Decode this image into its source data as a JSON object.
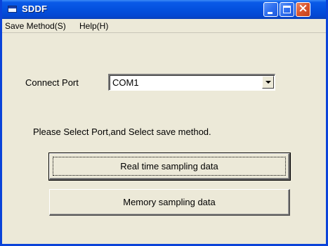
{
  "window": {
    "title": "SDDF",
    "title_icon": "app-window-icon"
  },
  "menu": {
    "items": [
      {
        "label": "Save Method(S)"
      },
      {
        "label": "Help(H)"
      }
    ]
  },
  "form": {
    "port_label": "Connect Port",
    "port_select": {
      "value": "COM1"
    },
    "instruction": "Please Select Port,and Select save method.",
    "real_time_button": "Real time sampling data",
    "memory_button": "Memory sampling data"
  },
  "colors": {
    "titlebar": "#0350de",
    "face": "#ece9d8",
    "close": "#d9542c"
  }
}
